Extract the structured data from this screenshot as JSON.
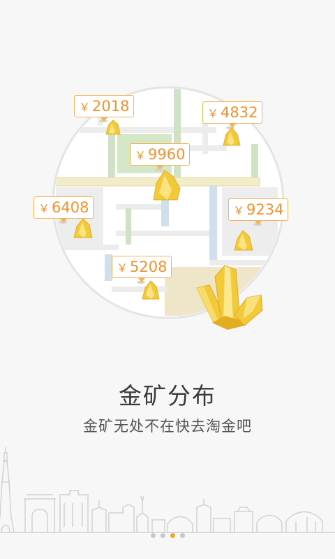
{
  "illustration": {
    "price_tags": [
      {
        "currency": "￥",
        "amount": "2018"
      },
      {
        "currency": "￥",
        "amount": "4832"
      },
      {
        "currency": "￥",
        "amount": "9960"
      },
      {
        "currency": "￥",
        "amount": "6408"
      },
      {
        "currency": "￥",
        "amount": "9234"
      },
      {
        "currency": "￥",
        "amount": "5208"
      }
    ],
    "accent_color": "#f0922d",
    "gold_color": "#f3c93c"
  },
  "onboarding": {
    "title": "金矿分布",
    "subtitle": "金矿无处不在快去淘金吧"
  },
  "pager": {
    "page_count": 4,
    "active_page": 3,
    "active_color": "#f0a52d"
  },
  "decor": {
    "skyline_icon": "city-skyline-icon"
  }
}
